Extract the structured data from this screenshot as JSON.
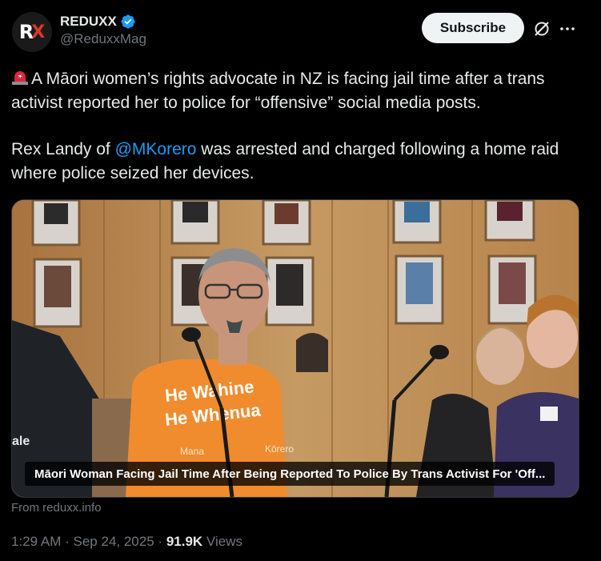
{
  "author": {
    "display_name": "REDUXX",
    "handle": "@ReduxxMag",
    "avatar_letter_1": "R",
    "avatar_letter_2": "X"
  },
  "actions": {
    "subscribe_label": "Subscribe"
  },
  "tweet": {
    "line1": "A Māori women’s rights advocate in NZ is facing jail time after a trans activist reported her to police for “offensive” social media posts.",
    "line2_before": "Rex Landy of ",
    "line2_mention": "@MKorero",
    "line2_after": " was arrested and charged following a home raid where police seized her devices."
  },
  "media": {
    "caption": "Māori Woman Facing Jail Time After Being Reported To Police By Trans Activist For 'Off...",
    "shirt_line1": "He Wahine",
    "shirt_line2": "He Whenua",
    "shirt_line3": "Mana",
    "shirt_line4": "Kōrero",
    "left_person_text": "ale"
  },
  "source": "From reduxx.info",
  "meta": {
    "time": "1:29 AM",
    "date": "Sep 24, 2025",
    "separator": "·",
    "views_count": "91.9K",
    "views_label": "Views"
  },
  "colors": {
    "background": "#000000",
    "text": "#e7e9ea",
    "muted": "#71767b",
    "link": "#1d9bf0",
    "verified": "#1d9bf0",
    "subscribe_bg": "#eff3f4"
  }
}
